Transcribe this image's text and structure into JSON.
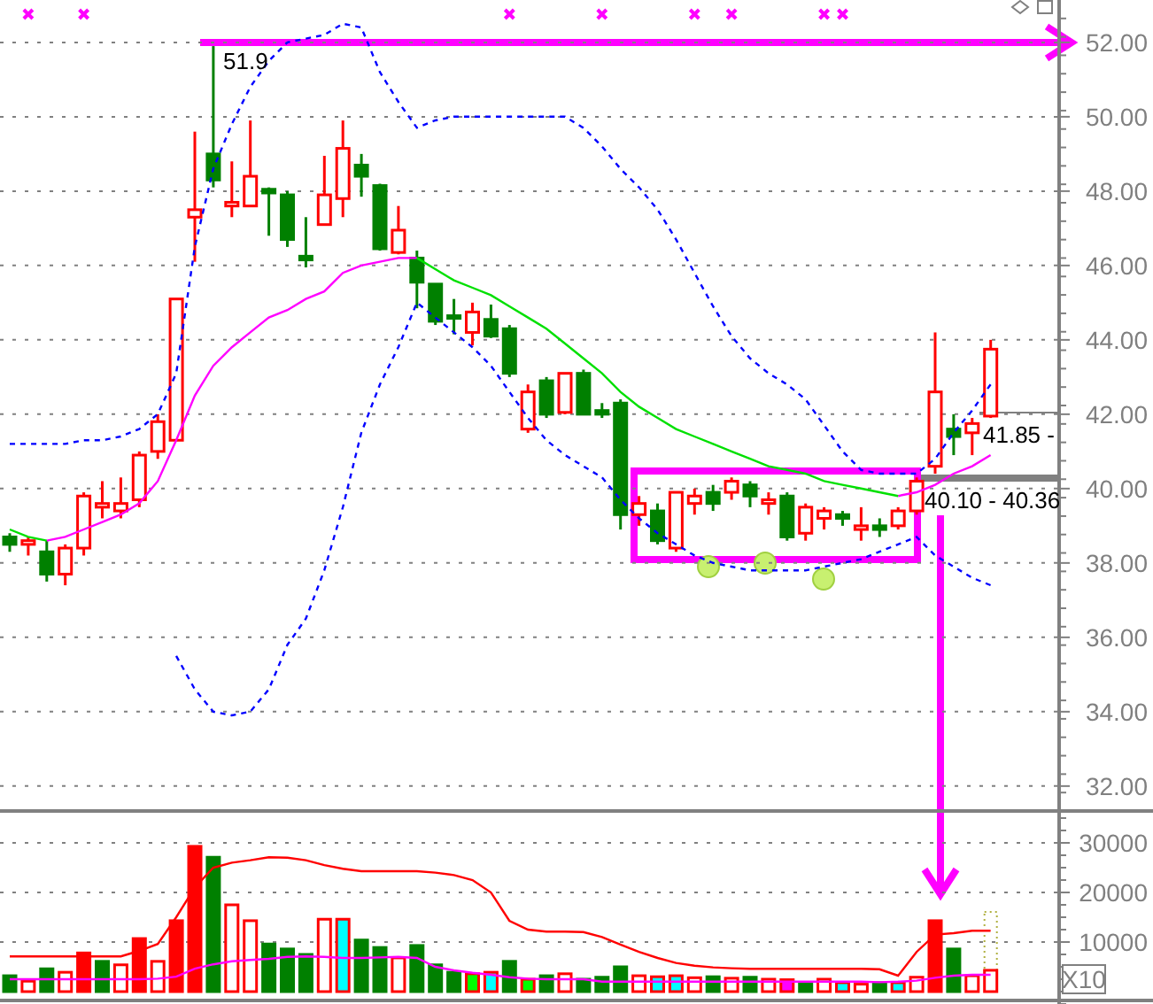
{
  "price_panel": {
    "high_label": "51.9",
    "price_tags": [
      "41.85 -",
      "40.10 - 40.36"
    ],
    "chart_data": {
      "type": "candlestick",
      "grid": true,
      "categories": [
        null,
        null,
        null,
        null,
        null,
        null,
        null,
        null,
        null,
        null,
        null,
        null,
        null,
        null,
        null,
        null,
        null,
        null,
        null,
        null,
        null,
        null,
        null,
        null,
        null,
        null,
        null,
        null,
        null,
        null,
        null,
        null,
        null,
        null,
        null,
        null,
        null,
        null,
        null,
        null,
        null,
        null,
        null,
        null,
        null,
        null,
        null,
        null,
        null,
        null,
        null,
        null,
        null,
        null
      ],
      "ylim": [
        31.33,
        53.14
      ],
      "yticks": [
        {
          "value": 52,
          "label": "52.00"
        },
        {
          "value": 50,
          "label": "50.00"
        },
        {
          "value": 48,
          "label": "48.00"
        },
        {
          "value": 46,
          "label": "46.00"
        },
        {
          "value": 44,
          "label": "44.00"
        },
        {
          "value": 42,
          "label": "42.00"
        },
        {
          "value": 40,
          "label": "40.00"
        },
        {
          "value": 38,
          "label": "38.00"
        },
        {
          "value": 36,
          "label": "36.00"
        },
        {
          "value": 34,
          "label": "34.00"
        },
        {
          "value": 32,
          "label": "32.00"
        }
      ],
      "ohlc": [
        [
          38.7,
          38.8,
          38.3,
          38.5
        ],
        [
          38.5,
          38.7,
          38.2,
          38.6
        ],
        [
          38.3,
          38.6,
          37.5,
          37.7
        ],
        [
          37.7,
          38.5,
          37.4,
          38.4
        ],
        [
          38.4,
          39.9,
          38.2,
          39.8
        ],
        [
          39.5,
          40.2,
          39.2,
          39.6
        ],
        [
          39.4,
          40.3,
          39.2,
          39.6
        ],
        [
          39.7,
          41.0,
          39.5,
          40.9
        ],
        [
          41.0,
          42.0,
          40.8,
          41.8
        ],
        [
          41.3,
          45.1,
          41.3,
          45.1
        ],
        [
          47.3,
          49.6,
          46.1,
          47.5
        ],
        [
          49.0,
          51.9,
          48.1,
          48.3
        ],
        [
          47.6,
          48.8,
          47.3,
          47.7
        ],
        [
          47.6,
          49.9,
          47.6,
          48.4
        ],
        [
          48.05,
          48.1,
          46.8,
          47.95
        ],
        [
          47.9,
          48.0,
          46.5,
          46.7
        ],
        [
          46.25,
          47.3,
          45.95,
          46.15
        ],
        [
          47.1,
          48.95,
          47.1,
          47.9
        ],
        [
          47.8,
          49.9,
          47.3,
          49.15
        ],
        [
          48.7,
          49.0,
          47.85,
          48.4
        ],
        [
          48.15,
          48.2,
          46.4,
          46.45
        ],
        [
          46.35,
          47.6,
          46.3,
          46.95
        ],
        [
          46.2,
          46.4,
          44.85,
          45.55
        ],
        [
          45.5,
          45.5,
          44.4,
          44.5
        ],
        [
          44.65,
          45.1,
          44.15,
          44.6
        ],
        [
          44.2,
          45.0,
          43.85,
          44.75
        ],
        [
          44.55,
          44.95,
          44.05,
          44.1
        ],
        [
          44.3,
          44.4,
          43.0,
          43.1
        ],
        [
          41.6,
          42.8,
          41.5,
          42.6
        ],
        [
          42.9,
          43.0,
          41.9,
          42.0
        ],
        [
          42.05,
          43.1,
          42.0,
          43.1
        ],
        [
          43.1,
          43.2,
          42.0,
          42.0
        ],
        [
          42.1,
          42.3,
          41.9,
          42.0
        ],
        [
          42.3,
          42.4,
          38.9,
          39.3
        ],
        [
          39.3,
          39.8,
          39.0,
          39.6
        ],
        [
          39.4,
          39.6,
          38.5,
          38.6
        ],
        [
          38.4,
          39.9,
          38.3,
          39.9
        ],
        [
          39.6,
          40.0,
          39.3,
          39.8
        ],
        [
          39.9,
          40.1,
          39.4,
          39.6
        ],
        [
          39.9,
          40.3,
          39.7,
          40.2
        ],
        [
          40.1,
          40.2,
          39.5,
          39.8
        ],
        [
          39.6,
          39.9,
          39.3,
          39.7
        ],
        [
          39.8,
          39.9,
          38.6,
          38.7
        ],
        [
          38.8,
          39.6,
          38.6,
          39.5
        ],
        [
          39.2,
          39.5,
          38.9,
          39.4
        ],
        [
          39.3,
          39.4,
          39.0,
          39.2
        ],
        [
          38.9,
          39.5,
          38.6,
          39.0
        ],
        [
          39.0,
          39.2,
          38.7,
          38.9
        ],
        [
          39.0,
          39.5,
          38.9,
          39.4
        ],
        [
          39.4,
          40.3,
          39.3,
          40.2
        ],
        [
          40.6,
          44.2,
          40.4,
          42.6
        ],
        [
          41.6,
          42.0,
          40.9,
          41.4
        ],
        [
          41.5,
          41.9,
          40.9,
          41.75
        ],
        [
          41.95,
          44.0,
          41.9,
          43.75
        ]
      ],
      "series": [
        {
          "type": "line",
          "color": "#0000ff",
          "line_style": "dashed",
          "values": [
            41.2,
            41.2,
            41.2,
            41.2,
            41.3,
            41.3,
            41.4,
            41.6,
            42.0,
            43.1,
            46.5,
            48.6,
            49.8,
            50.8,
            51.5,
            52.0,
            52.1,
            52.2,
            52.5,
            52.4,
            51.2,
            50.4,
            49.7,
            49.9,
            50.0,
            50.0,
            50.0,
            50.0,
            50.0,
            50.0,
            50.0,
            49.7,
            49.2,
            48.6,
            48.1,
            47.5,
            46.7,
            45.8,
            44.9,
            44.1,
            43.5,
            43.1,
            42.8,
            42.4,
            41.7,
            41.0,
            40.5,
            40.4,
            40.4,
            40.4,
            40.8,
            41.5,
            42.1,
            42.8
          ]
        },
        {
          "type": "line",
          "color": "#0000ff",
          "line_style": "dashed",
          "values": [
            null,
            null,
            null,
            null,
            null,
            null,
            null,
            null,
            null,
            35.5,
            34.6,
            34.0,
            33.9,
            34.0,
            34.6,
            35.8,
            36.5,
            37.8,
            39.5,
            41.5,
            42.8,
            43.8,
            45.0,
            44.6,
            44.2,
            43.8,
            43.3,
            42.6,
            41.9,
            41.3,
            40.9,
            40.6,
            40.3,
            39.7,
            39.2,
            38.8,
            38.5,
            38.2,
            38.0,
            37.9,
            37.8,
            37.8,
            37.8,
            37.8,
            37.9,
            38.0,
            38.1,
            38.3,
            38.5,
            38.7,
            38.2,
            37.9,
            37.6,
            37.4
          ]
        },
        {
          "type": "line",
          "color": "#ff00ff",
          "values": [
            null,
            null,
            38.6,
            38.7,
            38.9,
            39.1,
            39.3,
            39.6,
            40.2,
            41.3,
            42.5,
            43.3,
            43.8,
            44.2,
            44.6,
            44.8,
            45.1,
            45.3,
            45.8,
            46.0,
            46.1,
            46.2,
            46.2,
            null,
            null,
            null,
            null,
            null,
            null,
            null,
            null,
            null,
            null,
            null,
            null,
            null,
            null,
            null,
            null,
            null,
            null,
            null,
            null,
            null,
            null,
            null,
            null,
            null,
            39.8,
            39.9,
            40.1,
            40.4,
            40.6,
            40.9
          ]
        },
        {
          "type": "line",
          "color": "#00e000",
          "values": [
            38.9,
            38.7,
            38.6,
            null,
            null,
            null,
            null,
            null,
            null,
            null,
            null,
            null,
            null,
            null,
            null,
            null,
            null,
            null,
            null,
            null,
            null,
            null,
            46.2,
            45.9,
            45.6,
            45.4,
            45.2,
            44.9,
            44.6,
            44.3,
            43.9,
            43.5,
            43.1,
            42.6,
            42.2,
            41.9,
            41.6,
            41.4,
            41.2,
            41.0,
            40.8,
            40.6,
            40.5,
            40.4,
            40.2,
            40.1,
            40.0,
            39.9,
            39.8,
            null,
            null,
            null,
            null,
            null
          ]
        }
      ]
    }
  },
  "volume_panel": {
    "scale_label": "X10",
    "chart_data": {
      "type": "bar",
      "grid": true,
      "categories": [
        null,
        null,
        null,
        null,
        null,
        null,
        null,
        null,
        null,
        null,
        null,
        null,
        null,
        null,
        null,
        null,
        null,
        null,
        null,
        null,
        null,
        null,
        null,
        null,
        null,
        null,
        null,
        null,
        null,
        null,
        null,
        null,
        null,
        null,
        null,
        null,
        null,
        null,
        null,
        null,
        null,
        null,
        null,
        null,
        null,
        null,
        null,
        null,
        null,
        null,
        null,
        null,
        null,
        null
      ],
      "ylim": [
        0,
        30000
      ],
      "yticks": [
        {
          "value": 10000,
          "label": "10000"
        },
        {
          "value": 20000,
          "label": "20000"
        },
        {
          "value": 30000,
          "label": "30000"
        }
      ],
      "series": [
        {
          "values": [
            3200,
            2100,
            4600,
            3900,
            7800,
            6100,
            5400,
            10700,
            6100,
            14300,
            29300,
            27100,
            17500,
            14300,
            9600,
            8600,
            7500,
            14600,
            14600,
            10400,
            8900,
            6800,
            9300,
            5400,
            3900,
            3600,
            3900,
            6100,
            2500,
            3200,
            3600,
            2500,
            2900,
            5000,
            3200,
            3000,
            3200,
            2800,
            3000,
            2700,
            2900,
            2500,
            2400,
            1800,
            2500,
            1800,
            1500,
            1800,
            1800,
            2900,
            14300,
            8600,
            3200,
            4300
          ],
          "colors": [
            "#008000",
            "#ffffff",
            "#008000",
            "#ffffff",
            "#ff0000",
            "#008000",
            "#ffffff",
            "#ff0000",
            "#ffffff",
            "#ff0000",
            "#ff0000",
            "#008000",
            "#ffffff",
            "#ffffff",
            "#008000",
            "#008000",
            "#008000",
            "#ffffff",
            "#00ffff",
            "#008000",
            "#008000",
            "#ffffff",
            "#008000",
            "#008000",
            "#008000",
            "#00ff00",
            "#00ffff",
            "#008000",
            "#00ff00",
            "#008000",
            "#ffffff",
            "#008000",
            "#008000",
            "#008000",
            "#ffffff",
            "#00ffff",
            "#00ffff",
            "#ffffff",
            "#008000",
            "#ffffff",
            "#008000",
            "#ffffff",
            "#ff00ff",
            "#008000",
            "#ffffff",
            "#00ffff",
            "#ffffff",
            "#008000",
            "#00ffff",
            "#ffffff",
            "#ff0000",
            "#008000",
            "#ffffff",
            "#ffffff"
          ]
        },
        {
          "type": "line",
          "color": "#ff0000",
          "values": [
            7100,
            7100,
            7100,
            7100,
            7100,
            7100,
            7100,
            8200,
            9600,
            15000,
            21000,
            25000,
            26000,
            26500,
            27100,
            27000,
            26500,
            25500,
            24800,
            24300,
            24300,
            24300,
            24300,
            24000,
            23500,
            22500,
            20000,
            14300,
            12500,
            12100,
            12100,
            12000,
            11000,
            9500,
            8000,
            6800,
            5800,
            5200,
            4900,
            4700,
            4600,
            4600,
            4600,
            4600,
            4600,
            4600,
            4600,
            4500,
            3200,
            8000,
            11500,
            11800,
            12300,
            12300
          ]
        },
        {
          "type": "line",
          "color": "#ff00ff",
          "values": [
            2500,
            2500,
            2500,
            2500,
            2500,
            2500,
            2500,
            2500,
            2600,
            3000,
            4600,
            5500,
            6100,
            6400,
            6600,
            7000,
            7100,
            7000,
            6800,
            6800,
            6900,
            7000,
            6800,
            5000,
            4300,
            3800,
            3400,
            2900,
            2600,
            2500,
            2500,
            2500,
            2000,
            2000,
            2000,
            2000,
            2000,
            2000,
            2000,
            2000,
            2000,
            2000,
            2000,
            2000,
            2000,
            2000,
            2000,
            1900,
            2000,
            2200,
            2800,
            3200,
            3400,
            3400
          ]
        }
      ]
    }
  }
}
